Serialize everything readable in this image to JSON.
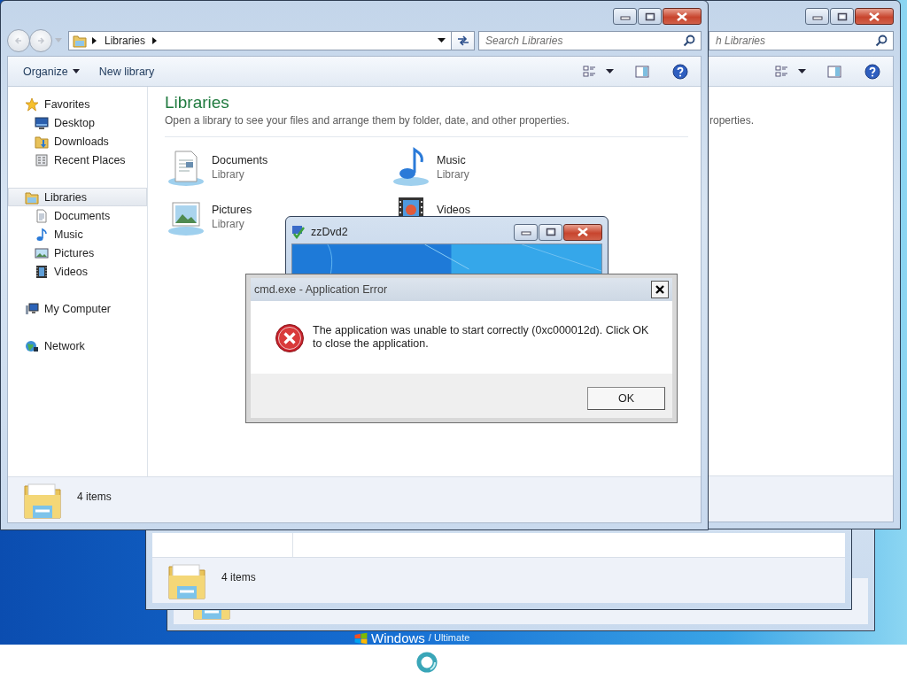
{
  "desktop": {
    "logo": {
      "brand": "Windows",
      "edition": "/ Ultimate"
    }
  },
  "middle_window": {
    "status_bar": {
      "item_count": "4 items"
    }
  },
  "right_window": {
    "search": {
      "placeholder": "h Libraries"
    },
    "description": "roperties."
  },
  "explorer": {
    "address": {
      "path": [
        "Libraries"
      ]
    },
    "search": {
      "placeholder": "Search Libraries"
    },
    "toolbar": {
      "buttons": [
        {
          "label": "Organize",
          "menu": true
        },
        {
          "label": "New library",
          "menu": false
        }
      ]
    },
    "sidebar": {
      "groups": [
        {
          "label": "Favorites",
          "selected": false,
          "children": [
            {
              "label": "Desktop",
              "selected": false
            },
            {
              "label": "Downloads",
              "selected": false
            },
            {
              "label": "Recent Places",
              "selected": false
            }
          ]
        },
        {
          "label": "Libraries",
          "selected": true,
          "children": [
            {
              "label": "Documents",
              "selected": false
            },
            {
              "label": "Music",
              "selected": false
            },
            {
              "label": "Pictures",
              "selected": false
            },
            {
              "label": "Videos",
              "selected": false
            }
          ]
        },
        {
          "label": "My Computer",
          "selected": false
        },
        {
          "label": "Network",
          "selected": false
        }
      ]
    },
    "content": {
      "title": "Libraries",
      "description": "Open a library to see your files and arrange them by folder, date, and other properties.",
      "libraries": [
        {
          "name": "Documents",
          "type": "Library"
        },
        {
          "name": "Music",
          "type": "Library"
        },
        {
          "name": "Pictures",
          "type": "Library"
        },
        {
          "name": "Videos"
        }
      ]
    },
    "status_bar": {
      "item_count": "4 items"
    }
  },
  "dvd_window": {
    "title": "zzDvd2"
  },
  "error_dialog": {
    "title": "cmd.exe - Application Error",
    "message": "The application was unable to start correctly (0xc000012d). Click OK to close the application.",
    "buttons": [
      "OK"
    ]
  }
}
